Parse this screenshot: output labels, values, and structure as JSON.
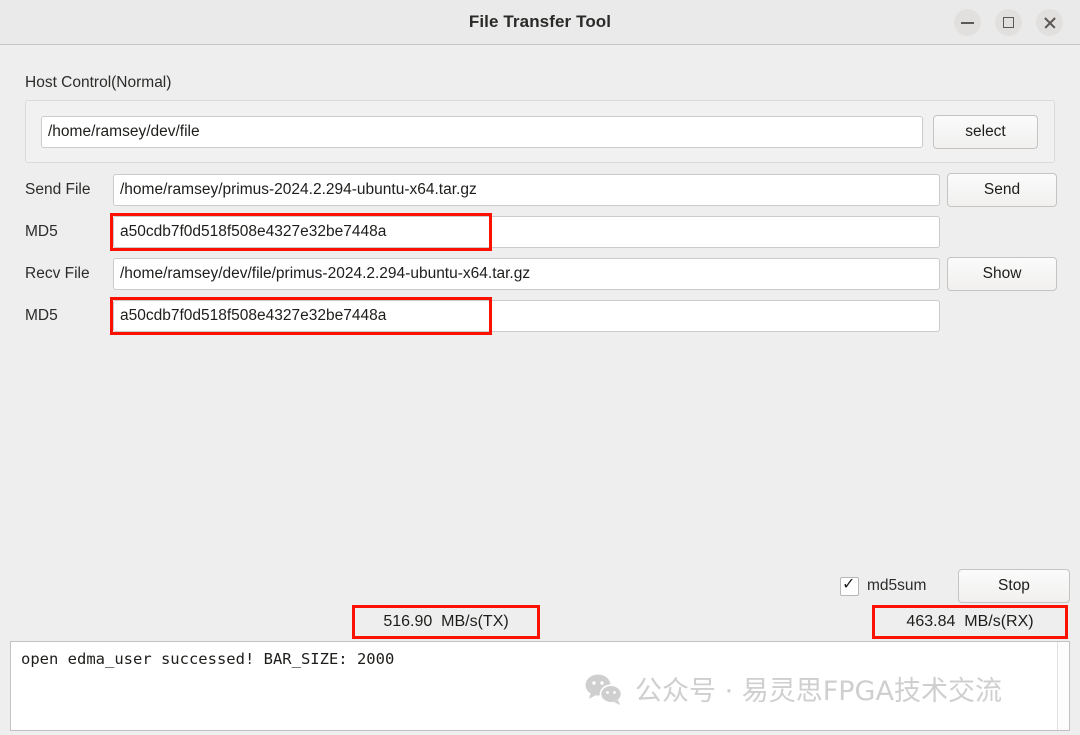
{
  "window": {
    "title": "File Transfer Tool",
    "controls": {
      "minimize": "minimize",
      "maximize": "maximize",
      "close": "close"
    }
  },
  "host_control": {
    "group_label": "Host Control(Normal)",
    "path_value": "/home/ramsey/dev/file",
    "select_label": "select"
  },
  "form": {
    "send_file_label": "Send File",
    "send_file_value": "/home/ramsey/primus-2024.2.294-ubuntu-x64.tar.gz",
    "send_button": "Send",
    "md5_send_label": "MD5",
    "md5_send_value": "a50cdb7f0d518f508e4327e32be7448a",
    "recv_file_label": "Recv File",
    "recv_file_value": "/home/ramsey/dev/file/primus-2024.2.294-ubuntu-x64.tar.gz",
    "show_button": "Show",
    "md5_recv_label": "MD5",
    "md5_recv_value": "a50cdb7f0d518f508e4327e32be7448a"
  },
  "controls": {
    "md5sum_label": "md5sum",
    "md5sum_checked": true,
    "stop_label": "Stop"
  },
  "rates": {
    "tx": "516.90  MB/s(TX)",
    "rx": "463.84  MB/s(RX)"
  },
  "console": {
    "log": "open edma_user successed! BAR_SIZE: 2000"
  },
  "watermark": {
    "text": "公众号 · 易灵思FPGA技术交流"
  },
  "colors": {
    "annotation": "#fc1000",
    "window_background": "#efeeee",
    "titlebar": "#ebeaea",
    "field_background": "#ffffff",
    "watermark": "#cfcfcf"
  }
}
